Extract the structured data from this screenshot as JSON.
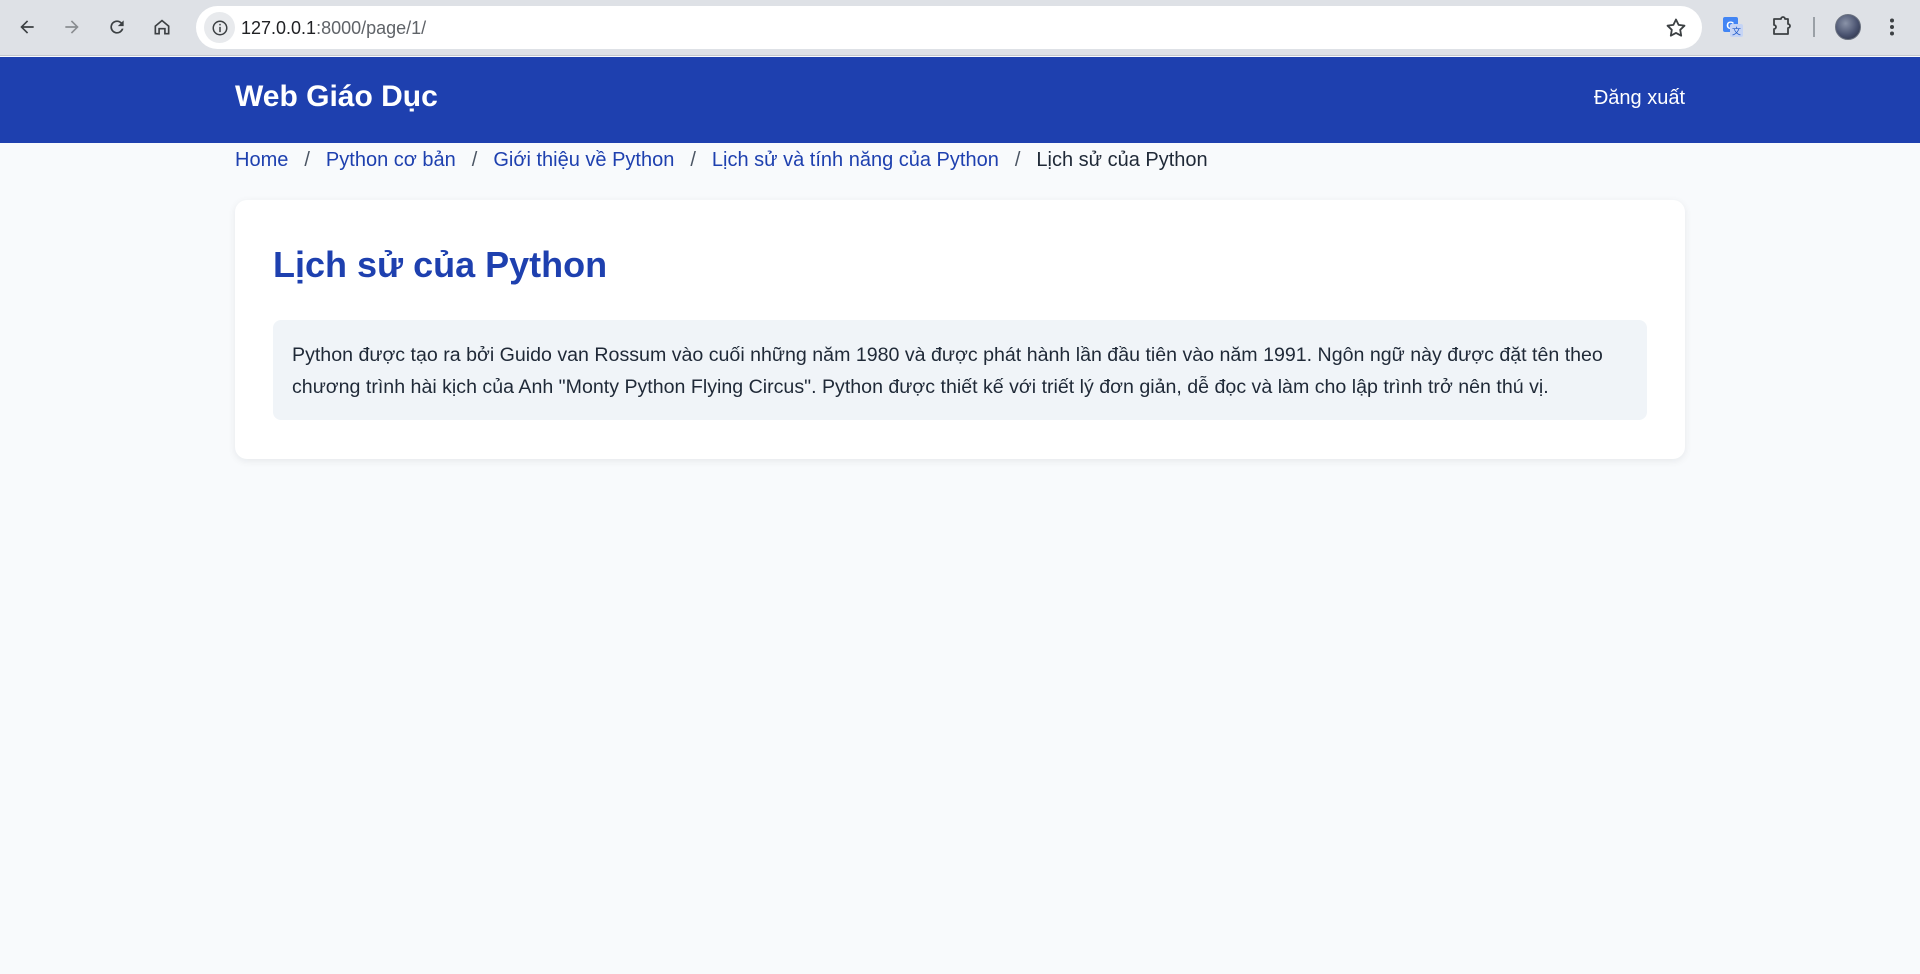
{
  "browser": {
    "url_host": "127.0.0.1",
    "url_path": ":8000/page/1/",
    "icons": [
      "back-icon",
      "forward-icon",
      "reload-icon",
      "home-icon",
      "site-info-icon",
      "bookmark-star-icon",
      "translate-icon",
      "extensions-icon",
      "profile-avatar",
      "menu-icon"
    ]
  },
  "header": {
    "brand": "Web Giáo Dục",
    "logout_label": "Đăng xuất",
    "background_color": "#1e40af"
  },
  "breadcrumb": {
    "items": [
      {
        "label": "Home"
      },
      {
        "label": "Python cơ bản"
      },
      {
        "label": "Giới thiệu về Python"
      },
      {
        "label": "Lịch sử và tính năng của Python"
      }
    ],
    "separator": "/",
    "current": "Lịch sử của Python"
  },
  "main": {
    "title": "Lịch sử của Python",
    "content": "Python được tạo ra bởi Guido van Rossum vào cuối những năm 1980 và được phát hành lần đầu tiên vào năm 1991. Ngôn ngữ này được đặt tên theo chương trình hài kịch của Anh \"Monty Python Flying Circus\". Python được thiết kế với triết lý đơn giản, dễ đọc và làm cho lập trình trở nên thú vị."
  }
}
